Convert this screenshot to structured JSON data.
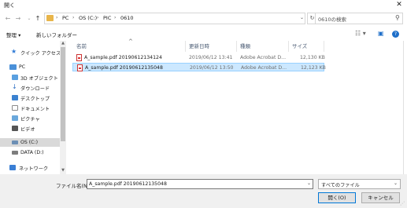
{
  "window": {
    "title": "開く",
    "close_glyph": "✕"
  },
  "nav": {
    "back": "←",
    "forward": "→",
    "recent": "⌄",
    "up": "↑"
  },
  "address": {
    "crumbs": [
      "PC",
      "OS (C:)",
      "PIC",
      "0610"
    ],
    "separator": "›",
    "dropdown": "⌄",
    "refresh": "↻"
  },
  "search": {
    "placeholder": "0610の検索",
    "icon": "search-icon"
  },
  "toolbar": {
    "organize": "整理 ▾",
    "new_folder": "新しいフォルダー",
    "view_glyph": "☷ ▾",
    "pane_glyph": "▣",
    "help_glyph": "?"
  },
  "sidebar": {
    "items": [
      {
        "label": "クイック アクセス",
        "icon": "star-icon",
        "color": "#2f7bd6"
      },
      {
        "label": "PC",
        "icon": "computer-icon",
        "color": "#4a90d9"
      },
      {
        "label": "3D オブジェクト",
        "icon": "cube-icon",
        "color": "#5aa0e0"
      },
      {
        "label": "ダウンロード",
        "icon": "download-icon",
        "color": "#2e6fc2"
      },
      {
        "label": "デスクトップ",
        "icon": "desktop-icon",
        "color": "#3b82d0"
      },
      {
        "label": "ドキュメント",
        "icon": "document-icon",
        "color": "#8a8a8a"
      },
      {
        "label": "ピクチャ",
        "icon": "picture-icon",
        "color": "#6aa8dc"
      },
      {
        "label": "ビデオ",
        "icon": "video-icon",
        "color": "#555555"
      },
      {
        "label": "OS (C:)",
        "icon": "drive-icon",
        "color": "#6c8fb5"
      },
      {
        "label": "DATA (D:)",
        "icon": "drive-icon",
        "color": "#7d7d7d"
      },
      {
        "label": "ネットワーク",
        "icon": "network-icon",
        "color": "#3a7fd5"
      }
    ],
    "scroll_up": "▲",
    "scroll_down": "▼"
  },
  "columns": {
    "name": "名前",
    "modified": "更新日時",
    "type": "種類",
    "size": "サイズ",
    "sort_glyph": "^"
  },
  "files": [
    {
      "name": "A_sample.pdf 20190612134124",
      "modified": "2019/06/12 13:41",
      "type": "Adobe Acrobat D...",
      "size": "12,130 KB",
      "selected": false
    },
    {
      "name": "A_sample.pdf 20190612135048",
      "modified": "2019/06/12 13:50",
      "type": "Adobe Acrobat D...",
      "size": "12,123 KB",
      "selected": true
    }
  ],
  "footer": {
    "filename_label": "ファイル名(N):",
    "filename_value": "A_sample.pdf 20190612135048",
    "filename_dd": "⌄",
    "filetype_value": "すべてのファイル",
    "filetype_dd": "⌄",
    "open_label": "開く(O)",
    "cancel_label": "キャンセル",
    "grip": "⋰"
  },
  "colors": {
    "selection": "#cce8ff",
    "accent": "#0078d7"
  }
}
